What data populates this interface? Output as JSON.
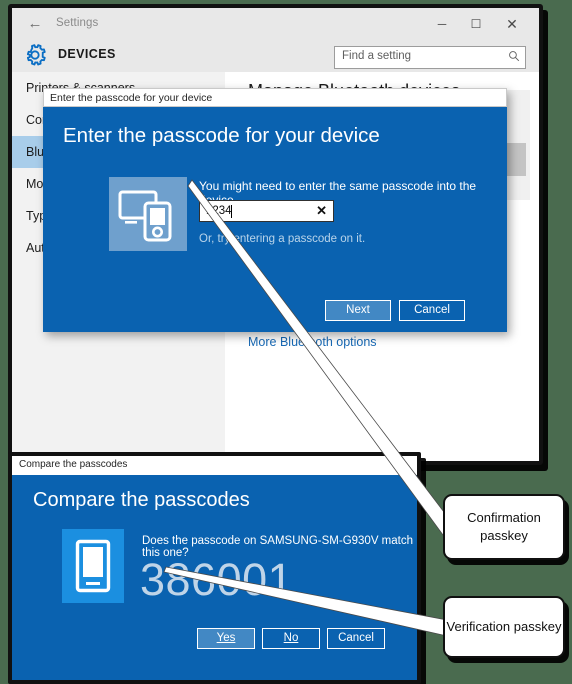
{
  "settings_window": {
    "titlebar": {
      "back_label": "←",
      "title": "Settings",
      "minimize": "─",
      "maximize": "☐",
      "close": "✕"
    },
    "header": {
      "gear_icon": "gear-icon",
      "heading": "DEVICES",
      "search_placeholder": "Find a setting",
      "search_value": "",
      "search_icon": "search-icon"
    },
    "sidebar": {
      "items": [
        {
          "label": "Printers & scanners",
          "selected": false
        },
        {
          "label": "Connected devices",
          "selected": false
        },
        {
          "label": "Bluetooth",
          "selected": true
        },
        {
          "label": "Mouse & touchpad",
          "selected": false
        },
        {
          "label": "Typing",
          "selected": false
        },
        {
          "label": "AutoPlay",
          "selected": false
        }
      ]
    },
    "content": {
      "heading": "Manage Bluetooth devices",
      "more_options_link": "More Bluetooth options"
    }
  },
  "passcode_dialog": {
    "titlebar_text": "Enter the passcode for your device",
    "heading": "Enter the passcode for your device",
    "device_icon": "monitor-and-phone-icon",
    "prompt": "You might need to enter the same passcode into the device.",
    "passcode_value": "1234",
    "clear_icon": "✕",
    "hint": "Or, try entering a passcode on it.",
    "next_label": "Next",
    "cancel_label": "Cancel"
  },
  "compare_window": {
    "titlebar_text": "Compare the passcodes",
    "heading": "Compare the passcodes",
    "device_icon": "phone-icon",
    "prompt": "Does the passcode on SAMSUNG-SM-G930V match this one?",
    "passcode": "386001",
    "yes_label": "Yes",
    "no_label": "No",
    "cancel_label": "Cancel"
  },
  "callouts": {
    "confirmation": "Confirmation passkey",
    "verification": "Verification passkey"
  },
  "colors": {
    "dialog_blue": "#0a62b0",
    "accent_blue": "#1769b5",
    "selected_nav": "#a8cdea",
    "passcode_text": "#bfd4e8",
    "tile_blue": "#6fa0cd",
    "phone_tile_blue": "#1b8fe0",
    "backdrop_green": "#4a6b4f"
  }
}
